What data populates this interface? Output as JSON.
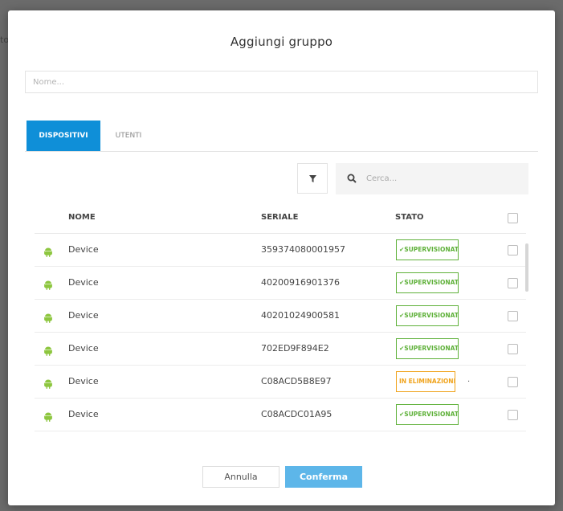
{
  "backdrop": {
    "fragment": "to"
  },
  "modal": {
    "title": "Aggiungi gruppo",
    "name_placeholder": "Nome...",
    "tabs": [
      {
        "label": "DISPOSITIVI",
        "active": true
      },
      {
        "label": "UTENTI",
        "active": false
      }
    ],
    "search_placeholder": "Cerca...",
    "table": {
      "headers": {
        "name": "NOME",
        "serial": "SERIALE",
        "status": "STATO"
      },
      "rows": [
        {
          "name": "Device",
          "serial": "359374080001957",
          "status": "SUPERVISIONAT...",
          "status_color": "#5fb13a"
        },
        {
          "name": "Device",
          "serial": "40200916901376",
          "status": "SUPERVISIONAT...",
          "status_color": "#5fb13a"
        },
        {
          "name": "Device",
          "serial": "40201024900581",
          "status": "SUPERVISIONAT...",
          "status_color": "#5fb13a"
        },
        {
          "name": "Device",
          "serial": "702ED9F894E2",
          "status": "SUPERVISIONAT...",
          "status_color": "#5fb13a"
        },
        {
          "name": "Device",
          "serial": "C08ACD5B8E97",
          "status": "IN ELIMINAZIONE...",
          "status_color": "#f0a31b",
          "extra": "."
        },
        {
          "name": "Device",
          "serial": "C08ACDC01A95",
          "status": "SUPERVISIONAT...",
          "status_color": "#5fb13a"
        }
      ]
    },
    "buttons": {
      "cancel": "Annulla",
      "confirm": "Conferma"
    },
    "colors": {
      "accent": "#0f8fd8",
      "confirm": "#5db6e9",
      "android": "#8dc63f"
    }
  }
}
